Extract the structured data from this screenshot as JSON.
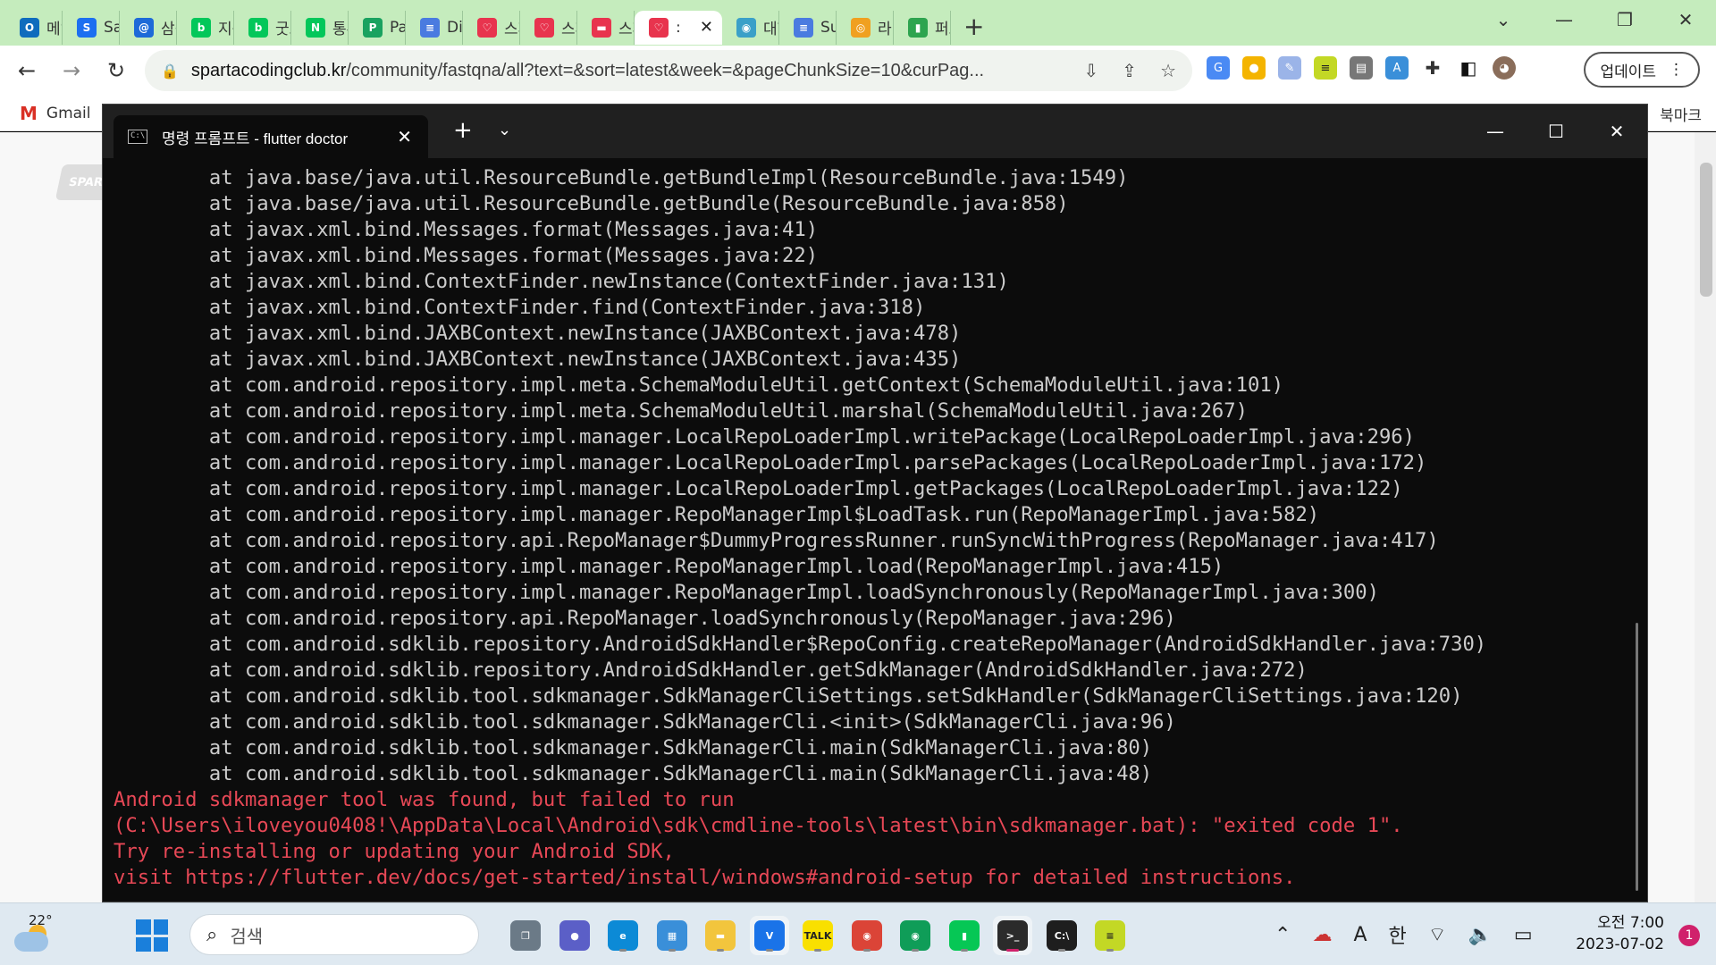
{
  "browser": {
    "tabs": [
      {
        "label": "메일",
        "color": "#0f6cbd",
        "glyph": "O"
      },
      {
        "label": "Sam",
        "color": "#1c6ff0",
        "glyph": "S"
      },
      {
        "label": "삼성",
        "color": "#1d6ad8",
        "glyph": "@"
      },
      {
        "label": "지구",
        "color": "#03c75a",
        "glyph": "b"
      },
      {
        "label": "굿모",
        "color": "#03c75a",
        "glyph": "b"
      },
      {
        "label": "통부",
        "color": "#03c75a",
        "glyph": "N"
      },
      {
        "label": "Pape",
        "color": "#1aa260",
        "glyph": "P"
      },
      {
        "label": "Diar",
        "color": "#4a7be0",
        "glyph": "≡"
      },
      {
        "label": "스피",
        "color": "#e8344e",
        "glyph": "♡"
      },
      {
        "label": "스피",
        "color": "#e8344e",
        "glyph": "♡"
      },
      {
        "label": "스피",
        "color": "#e8344e",
        "glyph": "▬"
      },
      {
        "label": ":",
        "color": "#e8344e",
        "glyph": "♡",
        "active": true
      },
      {
        "label": "대한",
        "color": "#3aa0c8",
        "glyph": "◉"
      },
      {
        "label": "Surv",
        "color": "#4a7be0",
        "glyph": "≡"
      },
      {
        "label": "라디",
        "color": "#f0a020",
        "glyph": "◎"
      },
      {
        "label": "퍼스",
        "color": "#2ea44f",
        "glyph": "▮"
      }
    ],
    "new_tab_icon": "+",
    "tab_search_icon": "⌄",
    "url_host": "spartacodingclub.kr",
    "url_path": "/community/fastqna/all?text=&sort=latest&week=&pageChunkSize=10&curPag...",
    "update_label": "업데이트",
    "bookmark_gmail": "Gmail",
    "bookmark_folder": "북마크",
    "page_logo": "SPAR"
  },
  "terminal": {
    "title": "명령 프롬프트 - flutter  doctor",
    "trace_lines": [
      "        at java.base/java.util.ResourceBundle.getBundleImpl(ResourceBundle.java:1549)",
      "        at java.base/java.util.ResourceBundle.getBundle(ResourceBundle.java:858)",
      "        at javax.xml.bind.Messages.format(Messages.java:41)",
      "        at javax.xml.bind.Messages.format(Messages.java:22)",
      "        at javax.xml.bind.ContextFinder.newInstance(ContextFinder.java:131)",
      "        at javax.xml.bind.ContextFinder.find(ContextFinder.java:318)",
      "        at javax.xml.bind.JAXBContext.newInstance(JAXBContext.java:478)",
      "        at javax.xml.bind.JAXBContext.newInstance(JAXBContext.java:435)",
      "        at com.android.repository.impl.meta.SchemaModuleUtil.getContext(SchemaModuleUtil.java:101)",
      "        at com.android.repository.impl.meta.SchemaModuleUtil.marshal(SchemaModuleUtil.java:267)",
      "        at com.android.repository.impl.manager.LocalRepoLoaderImpl.writePackage(LocalRepoLoaderImpl.java:296)",
      "        at com.android.repository.impl.manager.LocalRepoLoaderImpl.parsePackages(LocalRepoLoaderImpl.java:172)",
      "        at com.android.repository.impl.manager.LocalRepoLoaderImpl.getPackages(LocalRepoLoaderImpl.java:122)",
      "        at com.android.repository.impl.manager.RepoManagerImpl$LoadTask.run(RepoManagerImpl.java:582)",
      "        at com.android.repository.api.RepoManager$DummyProgressRunner.runSyncWithProgress(RepoManager.java:417)",
      "        at com.android.repository.impl.manager.RepoManagerImpl.load(RepoManagerImpl.java:415)",
      "        at com.android.repository.impl.manager.RepoManagerImpl.loadSynchronously(RepoManagerImpl.java:300)",
      "        at com.android.repository.api.RepoManager.loadSynchronously(RepoManager.java:296)",
      "        at com.android.sdklib.repository.AndroidSdkHandler$RepoConfig.createRepoManager(AndroidSdkHandler.java:730)",
      "        at com.android.sdklib.repository.AndroidSdkHandler.getSdkManager(AndroidSdkHandler.java:272)",
      "        at com.android.sdklib.tool.sdkmanager.SdkManagerCliSettings.setSdkHandler(SdkManagerCliSettings.java:120)",
      "        at com.android.sdklib.tool.sdkmanager.SdkManagerCli.<init>(SdkManagerCli.java:96)",
      "        at com.android.sdklib.tool.sdkmanager.SdkManagerCli.main(SdkManagerCli.java:80)",
      "        at com.android.sdklib.tool.sdkmanager.SdkManagerCli.main(SdkManagerCli.java:48)"
    ],
    "error_lines": [
      "Android sdkmanager tool was found, but failed to run",
      "(C:\\Users\\iloveyou0408!\\AppData\\Local\\Android\\sdk\\cmdline-tools\\latest\\bin\\sdkmanager.bat): \"exited code 1\".",
      "Try re-installing or updating your Android SDK,",
      "visit https://flutter.dev/docs/get-started/install/windows#android-setup for detailed instructions."
    ],
    "colors": {
      "trace": "#cccccc",
      "error": "#e74856",
      "background": "#0c0c0c"
    }
  },
  "taskbar": {
    "temperature": "22°",
    "search_placeholder": "검색",
    "apps": [
      {
        "name": "task-view",
        "glyph": "❐",
        "color": "#6b7a87"
      },
      {
        "name": "chat",
        "glyph": "●",
        "color": "#5b5fc7"
      },
      {
        "name": "edge",
        "glyph": "e",
        "color": "#0c8ad6"
      },
      {
        "name": "store",
        "glyph": "▦",
        "color": "#3a8fd9"
      },
      {
        "name": "file-explorer",
        "glyph": "▬",
        "color": "#f2c53d"
      },
      {
        "name": "app-v",
        "glyph": "V",
        "color": "#1a73e8"
      },
      {
        "name": "kakaotalk",
        "glyph": "TALK",
        "color": "#f9e000"
      },
      {
        "name": "chrome-1",
        "glyph": "◉",
        "color": "#db4437"
      },
      {
        "name": "chrome-2",
        "glyph": "◉",
        "color": "#0f9d58"
      },
      {
        "name": "line",
        "glyph": "▮",
        "color": "#06c755"
      },
      {
        "name": "terminal",
        "glyph": ">_",
        "color": "#2b2b2b"
      },
      {
        "name": "cmd",
        "glyph": "C:\\",
        "color": "#1e1e1e"
      },
      {
        "name": "notes",
        "glyph": "≡",
        "color": "#c3d825"
      }
    ],
    "ime_mode": "A",
    "ime_lang": "한",
    "time": "오전 7:00",
    "date": "2023-07-02",
    "notification_count": "1"
  }
}
